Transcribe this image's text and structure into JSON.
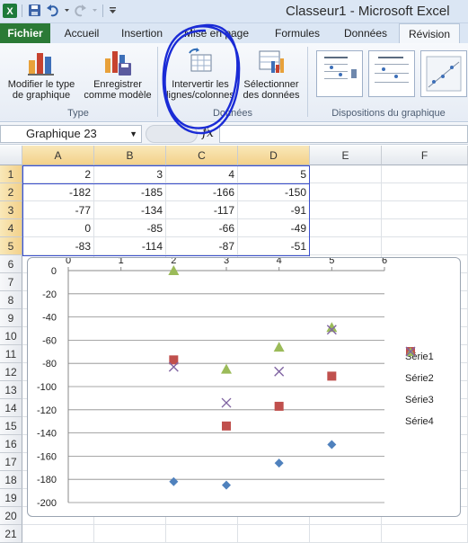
{
  "title_bar": {
    "title": "Classeur1 - Microsoft Excel"
  },
  "tabs": [
    {
      "label": "Fichier"
    },
    {
      "label": "Accueil"
    },
    {
      "label": "Insertion"
    },
    {
      "label": "Mise en page"
    },
    {
      "label": "Formules"
    },
    {
      "label": "Données"
    },
    {
      "label": "Révision"
    }
  ],
  "ribbon": {
    "type_group": {
      "label": "Type",
      "change_type": "Modifier le type\nde graphique",
      "save_template": "Enregistrer\ncomme modèle"
    },
    "data_group": {
      "label": "Données",
      "switch": "Intervertir les\nlignes/colonnes",
      "select_data": "Sélectionner\ndes données"
    },
    "layouts_group": {
      "label": "Dispositions du graphique"
    }
  },
  "formula_bar": {
    "name_box": "Graphique 23",
    "fx": "fx",
    "formula": ""
  },
  "sheet": {
    "columns": [
      "A",
      "B",
      "C",
      "D",
      "E",
      "F"
    ],
    "rows": [
      "1",
      "2",
      "3",
      "4",
      "5",
      "6",
      "7",
      "8",
      "9",
      "10",
      "11",
      "12",
      "13",
      "14",
      "15",
      "16",
      "17",
      "18",
      "19",
      "20",
      "21"
    ],
    "data": [
      [
        "2",
        "3",
        "4",
        "5"
      ],
      [
        "-182",
        "-185",
        "-166",
        "-150"
      ],
      [
        "-77",
        "-134",
        "-117",
        "-91"
      ],
      [
        "0",
        "-85",
        "-66",
        "-49"
      ],
      [
        "-83",
        "-114",
        "-87",
        "-51"
      ]
    ]
  },
  "chart_data": {
    "type": "scatter",
    "xlim": [
      0,
      6
    ],
    "ylim": [
      -200,
      0
    ],
    "x_ticks": [
      "0",
      "1",
      "2",
      "3",
      "4",
      "5",
      "6"
    ],
    "y_ticks": [
      "0",
      "-20",
      "-40",
      "-60",
      "-80",
      "-100",
      "-120",
      "-140",
      "-160",
      "-180",
      "-200"
    ],
    "grid": true,
    "legend_position": "right",
    "x": [
      2,
      3,
      4,
      5
    ],
    "series": [
      {
        "name": "Série1",
        "values": [
          -182,
          -185,
          -166,
          -150
        ],
        "color": "#4f81bd",
        "marker": "diamond"
      },
      {
        "name": "Série2",
        "values": [
          -77,
          -134,
          -117,
          -91
        ],
        "color": "#c0504d",
        "marker": "square"
      },
      {
        "name": "Série3",
        "values": [
          0,
          -85,
          -66,
          -49
        ],
        "color": "#9bbb59",
        "marker": "triangle"
      },
      {
        "name": "Série4",
        "values": [
          -83,
          -114,
          -87,
          -51
        ],
        "color": "#8064a2",
        "marker": "x"
      }
    ]
  }
}
